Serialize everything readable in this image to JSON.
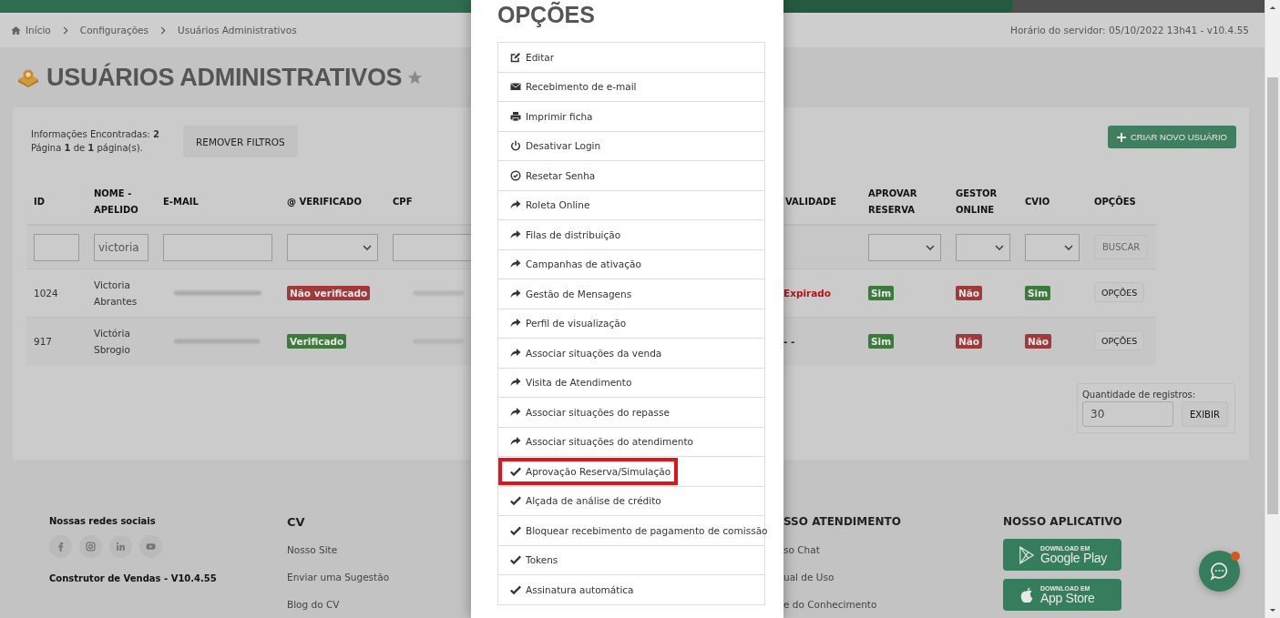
{
  "breadcrumb": [
    {
      "label": "Início"
    },
    {
      "label": "Configurações"
    },
    {
      "label": "Usuários Administrativos"
    }
  ],
  "server_time": "Horário do servidor: 05/10/2022 13h41 - v10.4.55",
  "page_title": "USUÁRIOS ADMINISTRATIVOS",
  "summary": [
    "Informações Encontradas: **2**",
    "Página **1** de **1** página(s)."
  ],
  "remove_filters": "REMOVER FILTROS",
  "create_button": "CRIAR NOVO USUÁRIO",
  "table": {
    "columns": [
      {
        "label": "ID"
      },
      {
        "label": "NOME - APELIDO"
      },
      {
        "label": "E-MAIL"
      },
      {
        "label": "@ VERIFICADO"
      },
      {
        "label": "CPF"
      },
      {
        "label": "VALIDADE"
      },
      {
        "label": "APROVAR RESERVA"
      },
      {
        "label": "GESTOR ONLINE"
      },
      {
        "label": "CVIO"
      },
      {
        "label": "OPÇÕES"
      }
    ],
    "filters": [
      {
        "kind": "text"
      },
      {
        "kind": "text",
        "value": "victoria"
      },
      {
        "kind": "text"
      },
      {
        "kind": "select"
      },
      {
        "kind": "text"
      },
      {
        "kind": "none"
      },
      {
        "kind": "select"
      },
      {
        "kind": "select"
      },
      {
        "kind": "select"
      },
      {
        "kind": "button",
        "label": "BUSCAR"
      }
    ],
    "rows": [
      {
        "id": "1024",
        "name": "Victoria Abrantes",
        "verified": {
          "text": "Não verificado",
          "color": "#a03a3a"
        },
        "validity": {
          "text": "Expirado",
          "expired": true
        },
        "approve": {
          "text": "Sim",
          "color": "#3b7a3b"
        },
        "manager": {
          "text": "Não",
          "color": "#a03a3a"
        },
        "cvio": {
          "text": "Sim",
          "color": "#3b7a3b"
        },
        "options": "OPÇÕES"
      },
      {
        "id": "917",
        "name": "Victória Sbrogio",
        "verified": {
          "text": "Verificado",
          "color": "#3b7a3b"
        },
        "validity": {
          "text": "- -",
          "expired": false
        },
        "approve": {
          "text": "Sim",
          "color": "#3b7a3b"
        },
        "manager": {
          "text": "Não",
          "color": "#a03a3a"
        },
        "cvio": {
          "text": "Não",
          "color": "#a03a3a"
        },
        "options": "OPÇÕES"
      }
    ]
  },
  "page_size": {
    "label": "Quantidade de registros:",
    "value": "30",
    "button": "EXIBIR"
  },
  "footer": {
    "social_title": "Nossas redes sociais",
    "version": "Construtor de Vendas - V10.4.55",
    "columns": [
      {
        "title": "CV",
        "links": [
          "Nosso Site",
          "Enviar uma Sugestão",
          "Blog do CV"
        ]
      },
      {
        "title": "SSO ATENDIMENTO",
        "links": [
          "so Chat",
          "ual de Uso",
          "e do Conhecimento"
        ]
      }
    ],
    "app_title": "NOSSO APLICATIVO",
    "stores": [
      {
        "kind": "google",
        "small": "DOWNLOAD EM",
        "name": "Google Play"
      },
      {
        "kind": "apple",
        "small": "DOWNLOAD EM",
        "name": "App Store"
      }
    ]
  },
  "chat": {
    "unread": true
  },
  "modal": {
    "title": "OPÇÕES",
    "items": [
      {
        "kind": "edit",
        "label": "Editar",
        "highlighted": false
      },
      {
        "kind": "mail",
        "label": "Recebimento de e-mail",
        "highlighted": false
      },
      {
        "kind": "print",
        "label": "Imprimir ficha",
        "highlighted": false
      },
      {
        "kind": "power",
        "label": "Desativar Login",
        "highlighted": false
      },
      {
        "kind": "check-circle",
        "label": "Resetar Senha",
        "highlighted": false
      },
      {
        "kind": "share",
        "label": "Roleta Online",
        "highlighted": false
      },
      {
        "kind": "share",
        "label": "Filas de distribuição",
        "highlighted": false
      },
      {
        "kind": "share",
        "label": "Campanhas de ativação",
        "highlighted": false
      },
      {
        "kind": "share",
        "label": "Gestão de Mensagens",
        "highlighted": false
      },
      {
        "kind": "share",
        "label": "Perfil de visualização",
        "highlighted": false
      },
      {
        "kind": "share",
        "label": "Associar situações da venda",
        "highlighted": false
      },
      {
        "kind": "share",
        "label": "Visita de Atendimento",
        "highlighted": false
      },
      {
        "kind": "share",
        "label": "Associar situações do repasse",
        "highlighted": false
      },
      {
        "kind": "share",
        "label": "Associar situações do atendimento",
        "highlighted": false
      },
      {
        "kind": "check",
        "label": "Aprovação Reserva/Simulação",
        "highlighted": true
      },
      {
        "kind": "check",
        "label": "Alçada de análise de crédito",
        "highlighted": false
      },
      {
        "kind": "check",
        "label": "Bloquear recebimento de pagamento de comissão",
        "highlighted": false
      },
      {
        "kind": "check",
        "label": "Tokens",
        "highlighted": false
      },
      {
        "kind": "check",
        "label": "Assinatura automática",
        "highlighted": false
      }
    ]
  }
}
